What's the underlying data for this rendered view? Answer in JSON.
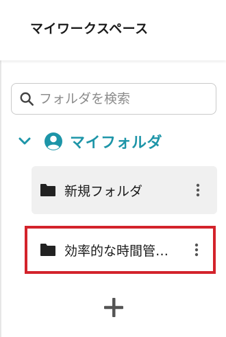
{
  "header": {
    "title": "マイワークスペース"
  },
  "search": {
    "placeholder": "フォルダを検索",
    "value": ""
  },
  "my_folder": {
    "label": "マイフォルダ",
    "expanded": true,
    "accent_color": "#1d95a8"
  },
  "folders": [
    {
      "label": "新規フォルダ",
      "state": "hover"
    },
    {
      "label": "効率的な時間管…",
      "state": "highlighted"
    }
  ],
  "icons": {
    "search": "search-icon",
    "chevron": "chevron-down-icon",
    "user": "user-circle-icon",
    "folder": "folder-icon",
    "more": "more-vertical-icon",
    "add": "plus-icon"
  },
  "colors": {
    "highlight_border": "#d3232b",
    "hover_bg": "#f0f0f0",
    "add_icon": "#555555"
  }
}
